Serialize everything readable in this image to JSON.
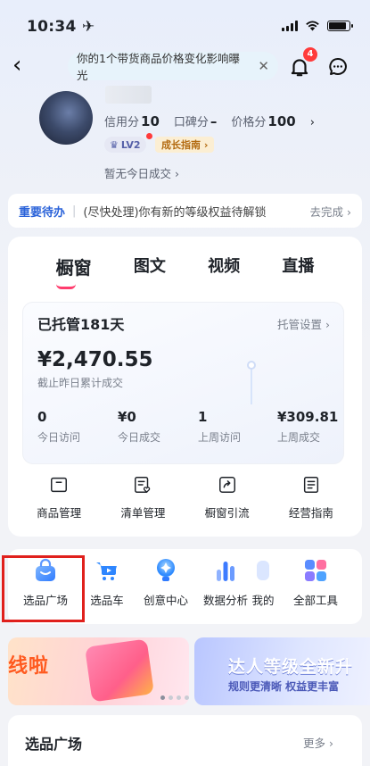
{
  "status": {
    "time": "10:34 ✈"
  },
  "nav": {
    "notice": "你的1个带货商品价格变化影响曝光",
    "badge_count": "4"
  },
  "profile": {
    "name": "",
    "credit_label": "信用分",
    "credit_value": "10",
    "rep_label": "口碑分",
    "rep_value": "–",
    "price_label": "价格分",
    "price_value": "100",
    "level": "LV2",
    "guide": "成长指南 ›",
    "today": "暂无今日成交 ›"
  },
  "todo": {
    "title": "重要待办",
    "message": "(尽快处理)你有新的等级权益待解锁",
    "action": "去完成 ›"
  },
  "tabs": [
    {
      "label": "橱窗"
    },
    {
      "label": "图文"
    },
    {
      "label": "视频"
    },
    {
      "label": "直播"
    }
  ],
  "stats": {
    "managed_days": "已托管181天",
    "managed_settings": "托管设置 ›",
    "amount": "¥2,470.55",
    "amount_label": "截止昨日累计成交",
    "metrics": [
      {
        "value": "0",
        "label": "今日访问"
      },
      {
        "value": "¥0",
        "label": "今日成交"
      },
      {
        "value": "1",
        "label": "上周访问"
      },
      {
        "value": "¥309.81",
        "label": "上周成交"
      }
    ]
  },
  "tools": [
    {
      "label": "商品管理",
      "icon": "box-icon"
    },
    {
      "label": "清单管理",
      "icon": "list-heart-icon"
    },
    {
      "label": "橱窗引流",
      "icon": "share-icon"
    },
    {
      "label": "经营指南",
      "icon": "document-icon"
    }
  ],
  "quick": [
    {
      "label": "选品广场",
      "icon": "shopping-bag-icon",
      "color": "#3d8bff"
    },
    {
      "label": "选品车",
      "icon": "cart-icon",
      "color": "#2e8cff"
    },
    {
      "label": "创意中心",
      "icon": "lightbulb-icon",
      "color": "#3aa3ff"
    },
    {
      "label": "数据分析",
      "icon": "bar-chart-icon",
      "color": "#4b7bff"
    },
    {
      "label": "我的",
      "icon": "user-icon",
      "color": "#8fb2ff"
    },
    {
      "label": "全部工具",
      "icon": "grid-icon",
      "color": "#5a8cff"
    }
  ],
  "banners": {
    "left_text": "线啦",
    "right_title": "达人等级全新升",
    "right_sub": "规则更清晰 权益更丰富"
  },
  "section": {
    "title": "选品广场",
    "more": "更多 ›"
  }
}
